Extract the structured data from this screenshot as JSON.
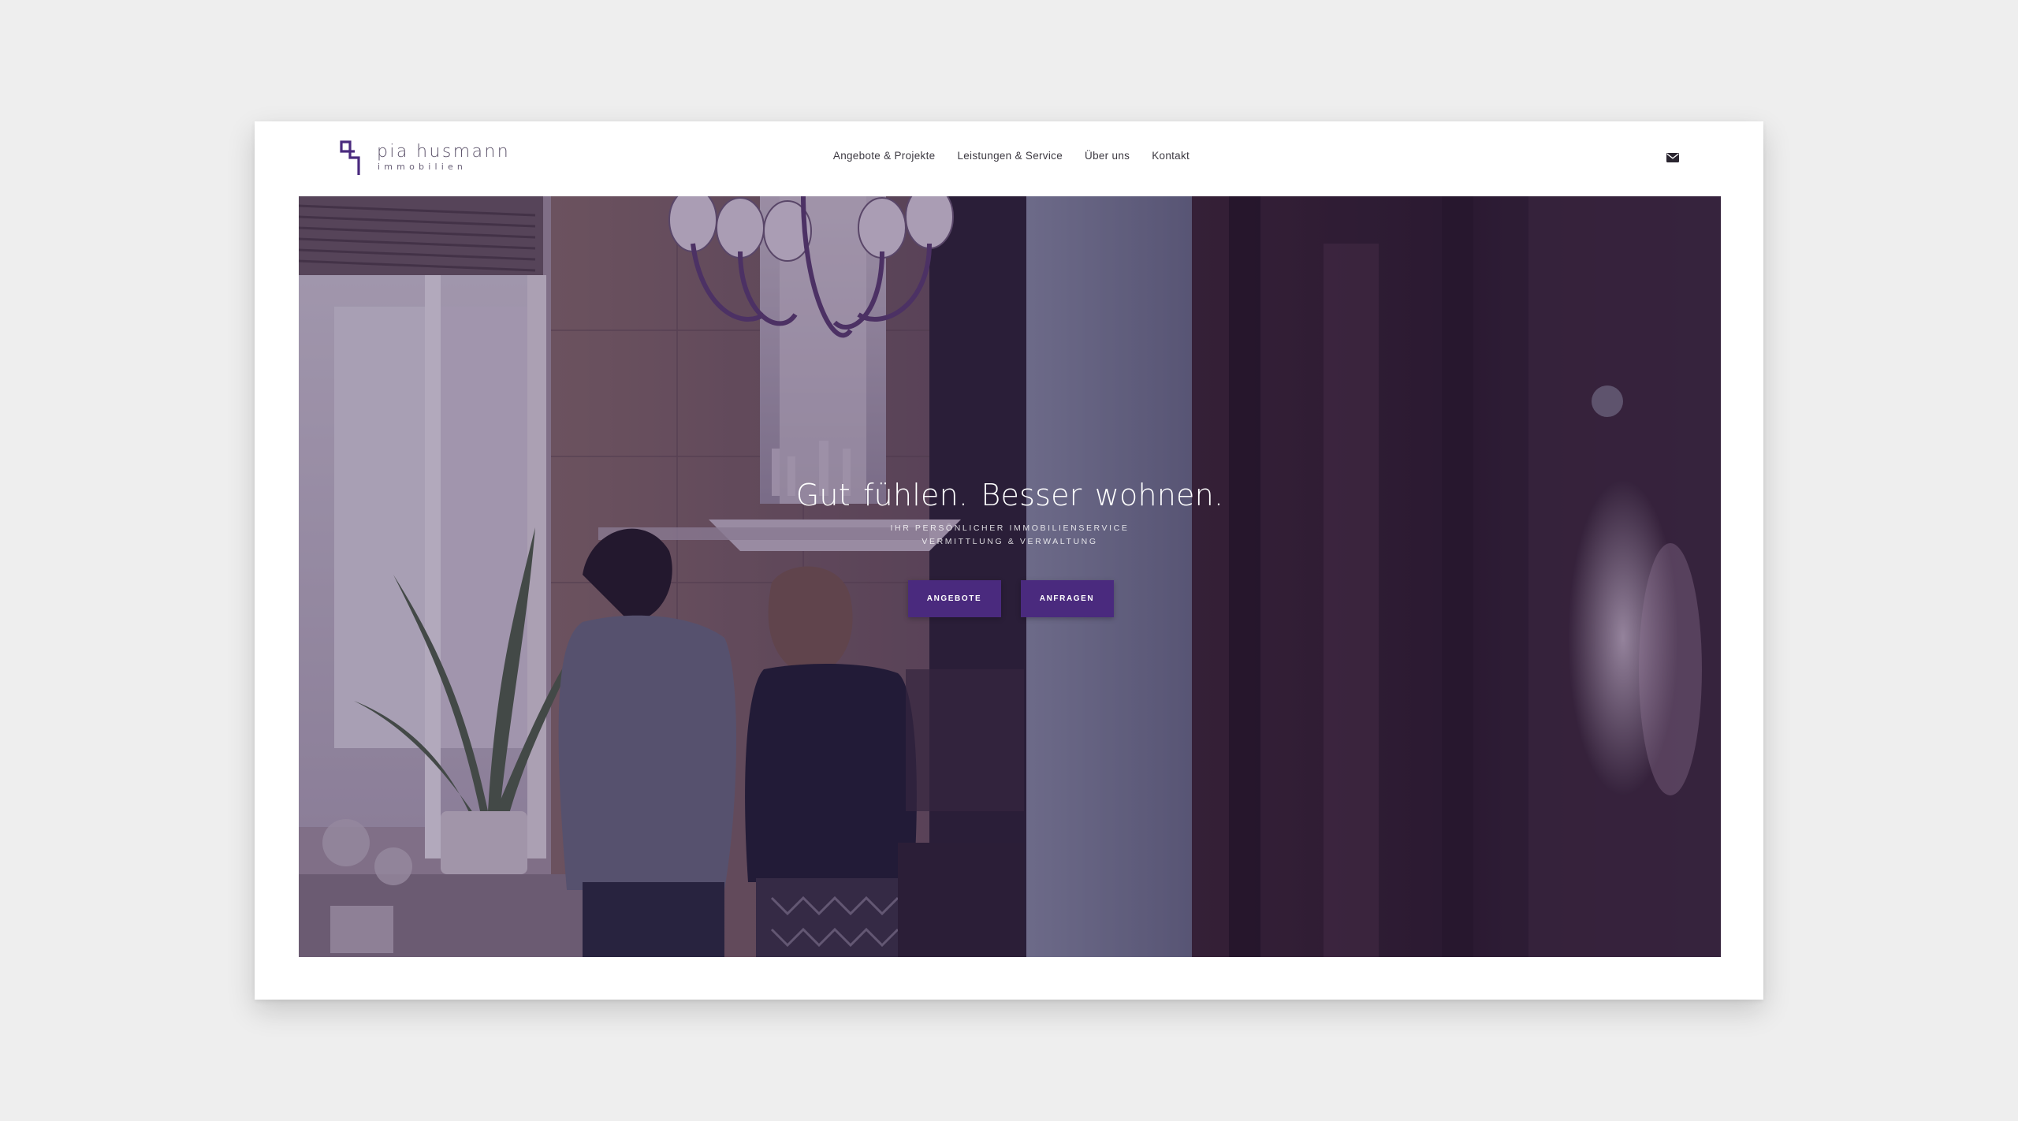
{
  "brand": {
    "name": "pia husmann",
    "subtitle": "immobilien",
    "accent_color": "#4a2a7e"
  },
  "nav": {
    "items": [
      {
        "label": "Angebote &  Projekte"
      },
      {
        "label": "Leistungen & Service"
      },
      {
        "label": "Über uns"
      },
      {
        "label": "Kontakt"
      }
    ],
    "mail_icon": "envelope-icon"
  },
  "hero": {
    "title": "Gut fühlen.  Besser wohnen.",
    "subtitle_line1": "IHR PERSÖNLICHER IMMOBILIENSERVICE",
    "subtitle_line2": "VERMITTLUNG & VERWALTUNG",
    "buttons": [
      {
        "label": "ANGEBOTE"
      },
      {
        "label": "ANFRAGEN"
      }
    ],
    "background": "photo of a couple cooking in a kitchen"
  }
}
